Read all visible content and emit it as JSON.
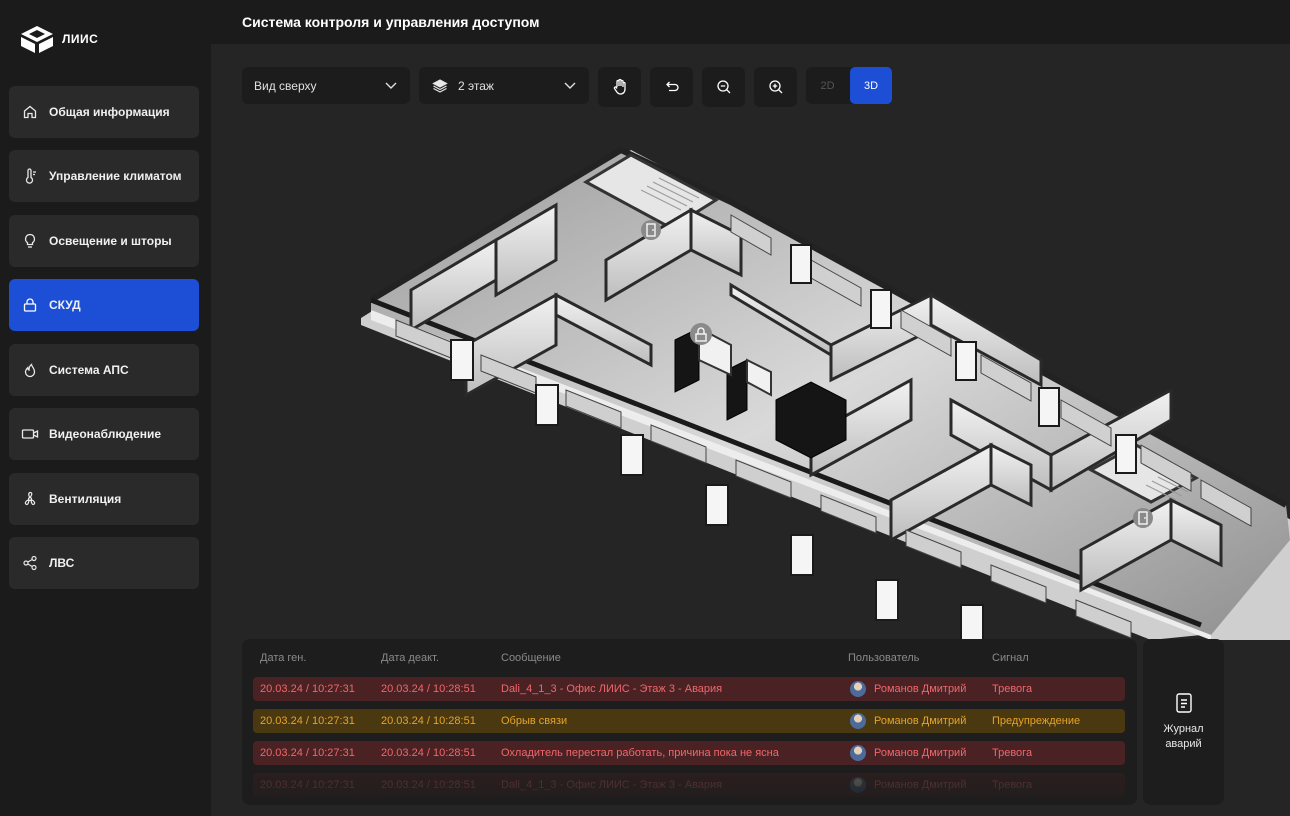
{
  "app": {
    "logo_text": "ЛИИС"
  },
  "header": {
    "title": "Система контроля и управления доступом"
  },
  "sidebar": {
    "items": [
      {
        "label": "Общая информация",
        "icon": "home-icon",
        "active": false
      },
      {
        "label": "Управление климатом",
        "icon": "thermometer-icon",
        "active": false
      },
      {
        "label": "Освещение и шторы",
        "icon": "lightbulb-icon",
        "active": false
      },
      {
        "label": "СКУД",
        "icon": "lock-icon",
        "active": true
      },
      {
        "label": "Система АПС",
        "icon": "fire-icon",
        "active": false
      },
      {
        "label": "Видеонаблюдение",
        "icon": "camera-icon",
        "active": false
      },
      {
        "label": "Вентиляция",
        "icon": "fan-icon",
        "active": false
      },
      {
        "label": "ЛВС",
        "icon": "network-icon",
        "active": false
      }
    ]
  },
  "toolbar": {
    "view_select": "Вид сверху",
    "floor_select": "2 этаж",
    "tools": [
      "hand-icon",
      "undo-icon",
      "zoom-out-icon",
      "zoom-in-icon"
    ],
    "mode_2d": "2D",
    "mode_3d": "3D",
    "active_mode": "3D"
  },
  "map": {
    "markers": [
      "door-icon",
      "lock-icon",
      "door-icon"
    ]
  },
  "alarms": {
    "columns": [
      "Дата ген.",
      "Дата деакт.",
      "Сообщение",
      "Пользователь",
      "Сигнал"
    ],
    "rows": [
      {
        "gen": "20.03.24 / 10:27:31",
        "deact": "20.03.24 / 10:28:51",
        "message": "Dali_4_1_3 - Офис ЛИИС - Этаж 3 - Авария",
        "user": "Романов Дмитрий",
        "signal": "Тревога",
        "level": "alarm"
      },
      {
        "gen": "20.03.24 / 10:27:31",
        "deact": "20.03.24 / 10:28:51",
        "message": "Обрыв связи",
        "user": "Романов Дмитрий",
        "signal": "Предупреждение",
        "level": "warn"
      },
      {
        "gen": "20.03.24 / 10:27:31",
        "deact": "20.03.24 / 10:28:51",
        "message": "Охладитель перестал работать, причина пока не ясна",
        "user": "Романов Дмитрий",
        "signal": "Тревога",
        "level": "alarm"
      },
      {
        "gen": "20.03.24 / 10:27:31",
        "deact": "20.03.24 / 10:28:51",
        "message": "Dali_4_1_3 - Офис ЛИИС - Этаж 3 - Авария",
        "user": "Романов Дмитрий",
        "signal": "Тревога",
        "level": "alarm"
      }
    ]
  },
  "journal": {
    "label": "Журнал аварий"
  },
  "colors": {
    "accent": "#1c4fd6",
    "alarm_text": "#f0676b",
    "alarm_bg": "#4a2224",
    "warn_text": "#e5a428",
    "warn_bg": "#4a3811"
  }
}
